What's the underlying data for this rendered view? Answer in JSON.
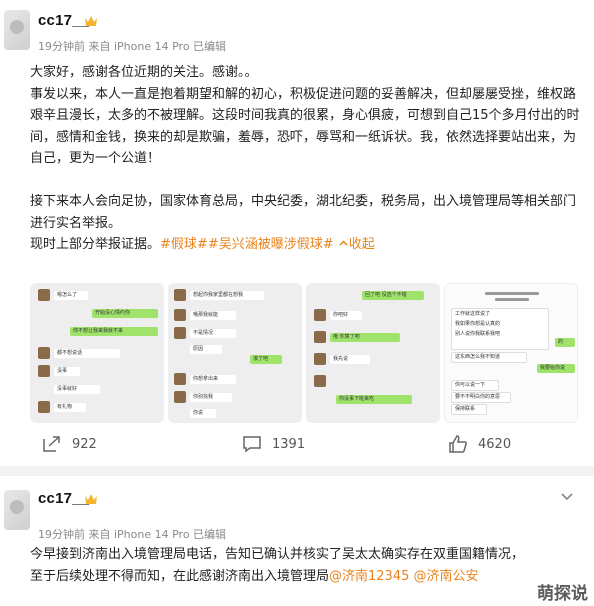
{
  "post1": {
    "username": "cc17__",
    "meta": "19分钟前 来自 iPhone 14 Pro 已编辑",
    "paragraphs": [
      "大家好，感谢各位近期的关注。感谢。。",
      "事发以来，本人一直是抱着期望和解的初心，积极促进问题的妥善解决，但却屡屡受挫，维权路艰辛且漫长，太多的不被理解。这段时间我真的很累，身心俱疲，可想到自己15个多月付出的时间，感情和金钱，换来的却是欺骗，羞辱，恐吓，辱骂和一纸诉状。我，依然选择要站出来，为自己，更为一个公道！",
      "接下来本人会向足协，国家体育总局，中央纪委，湖北纪委，税务局，出入境管理局等相关部门进行实名举报。"
    ],
    "last_line_prefix": "现时上部分举报证据。",
    "tags": [
      "#假球#",
      "#吴兴涵被曝涉假球#"
    ],
    "collapse_label": "收起",
    "screenshots": {
      "s1": [
        "嗯怎么了",
        "开始没心情约你",
        "你不想让我来我就不来",
        "都不想说话",
        "没事",
        "没事就好",
        "能说说吗",
        "有礼物"
      ],
      "s2": [
        "想起你我家里都在想我",
        "哦那我就能",
        "不是情况",
        "原因",
        "滚了吧",
        "你想拿出来",
        "你别找我",
        "你说"
      ],
      "s3": [
        "回了吧 没选个不错",
        "你吧好",
        "哦 你算了吧",
        "我先说",
        "你没事下班来吃"
      ],
      "s4": [
        "工作就这样说了",
        "我如果你想是认真的",
        "别人说你我联系我吧",
        "这东西怎么我不知道",
        "我要给你说",
        "你可以说一下",
        "要不不明白你的意思",
        "保持联系",
        "的"
      ]
    },
    "actions": {
      "repost_count": "922",
      "comment_count": "1391",
      "like_count": "4620"
    }
  },
  "post2": {
    "username": "cc17__",
    "meta": "19分钟前 来自 iPhone 14 Pro 已编辑",
    "line1": "今早接到济南出入境管理局电话，告知已确认并核实了吴太太确实存在双重国籍情况，",
    "line2_prefix": "至于后续处理不得而知，在此感谢济南出入境管理局",
    "mentions": [
      "@济南12345",
      "@济南公安"
    ]
  },
  "watermark": "萌探说",
  "colors": {
    "accent": "#e8831b",
    "crown": "#f5b52e",
    "meta": "#8a8a8a",
    "chat_green": "#9fe36b"
  }
}
